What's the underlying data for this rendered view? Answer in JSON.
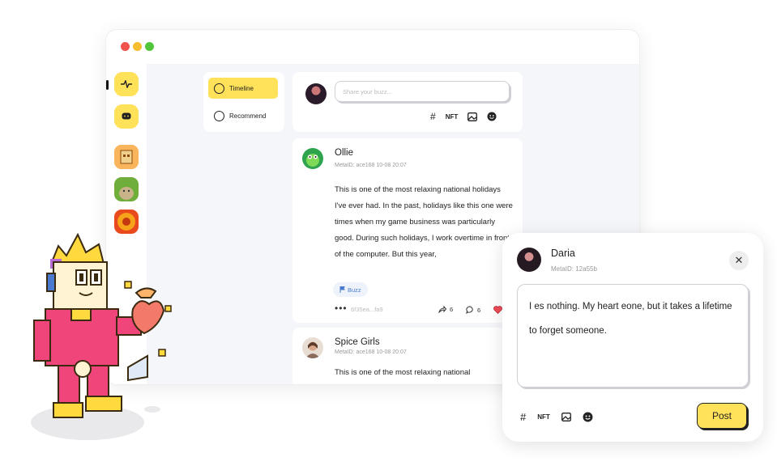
{
  "window": {
    "controls": [
      "close",
      "minimize",
      "maximize"
    ]
  },
  "sidebar": {
    "items": [
      {
        "icon": "activity-icon",
        "active": true
      },
      {
        "icon": "chat-icon"
      },
      {
        "icon": "avatar-box"
      },
      {
        "icon": "avatar-cat"
      },
      {
        "icon": "avatar-flower"
      }
    ]
  },
  "tabs": [
    {
      "label": "Timeline",
      "icon": "clock-icon",
      "active": true
    },
    {
      "label": "Recommend",
      "icon": "target-icon"
    }
  ],
  "composer": {
    "placeholder": "Share your buzz...",
    "tools": [
      "#",
      "NFT",
      "image-icon",
      "emoji-icon"
    ]
  },
  "posts": [
    {
      "name": "Ollie",
      "meta": "MetaID: ace168 10-08 20:07",
      "body": "This is one of the most relaxing national holidays I've ever had. In the past, holidays like this one were times when my game business was particularly good. During such holidays, I work overtime in front of the computer. But this year,",
      "tag": "Buzz",
      "hash": "6f35ea...fa9",
      "reposts": "6",
      "comments": "6"
    },
    {
      "name": "Spice Girls",
      "meta": "MetaID: ace168 10-08 20:07",
      "body": "This is one of the most relaxing national"
    }
  ],
  "popup": {
    "name": "Daria",
    "meta": "MetaID: 12a55b",
    "text": "I es nothing. My heart eone, but it takes a lifetime to forget someone.",
    "tools": [
      "#",
      "NFT",
      "image-icon",
      "emoji-icon"
    ],
    "post_label": "Post"
  },
  "colors": {
    "accent": "#ffe15a",
    "tag_blue": "#4a7ad0",
    "mascot_pink": "#f0457a"
  }
}
